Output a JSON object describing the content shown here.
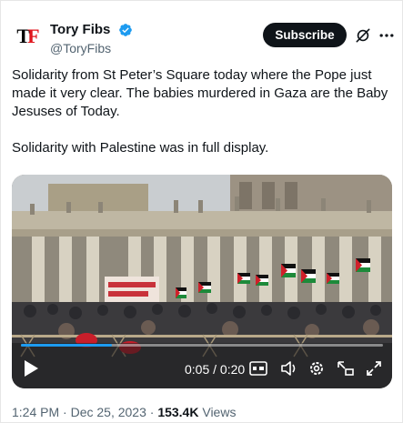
{
  "author": {
    "display_name": "Tory Fibs",
    "handle": "@ToryFibs",
    "avatar_letters": {
      "first": "T",
      "second": "F"
    },
    "verified": true,
    "verified_color": "#1d9bf0"
  },
  "actions": {
    "subscribe_label": "Subscribe",
    "grok_icon": "grok-icon",
    "more_icon": "more-icon"
  },
  "tweet": {
    "paragraph_1": "Solidarity from St Peter’s Square today where the Pope just made it very clear. The babies murdered in Gaza are the Baby Jesuses of Today.",
    "paragraph_2": "Solidarity with Palestine was in full display."
  },
  "video": {
    "time_display": "0:05 / 0:20",
    "progress": 0.25,
    "progress_color": "#1d9bf0",
    "controls": [
      "play-icon",
      "captions-icon",
      "volume-icon",
      "settings-icon",
      "pip-icon",
      "expand-icon"
    ]
  },
  "footer": {
    "time_date": "1:24 PM · Dec 25, 2023 · ",
    "views_count": "153.4K",
    "views_label": " Views"
  }
}
